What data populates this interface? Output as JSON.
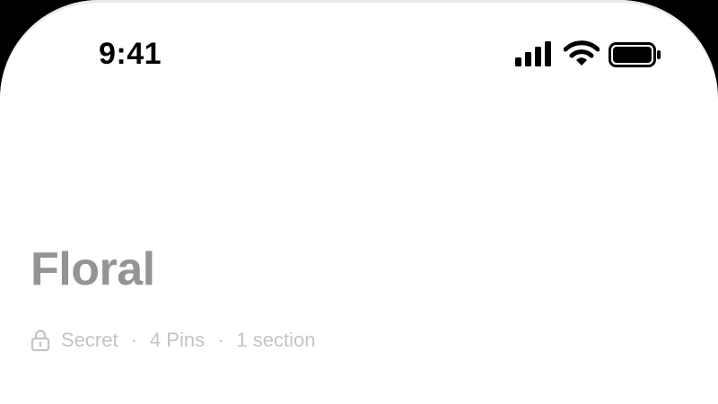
{
  "status_bar": {
    "time": "9:41",
    "icons": [
      "cellular-signal-icon",
      "wifi-icon",
      "battery-icon"
    ]
  },
  "board": {
    "title": "Floral",
    "privacy_icon": "lock-icon",
    "privacy": "Secret",
    "separator": "·",
    "pins": "4 Pins",
    "sections": "1 section"
  },
  "colors": {
    "title": "#949494",
    "meta": "#c4c4c4",
    "status": "#000000"
  }
}
